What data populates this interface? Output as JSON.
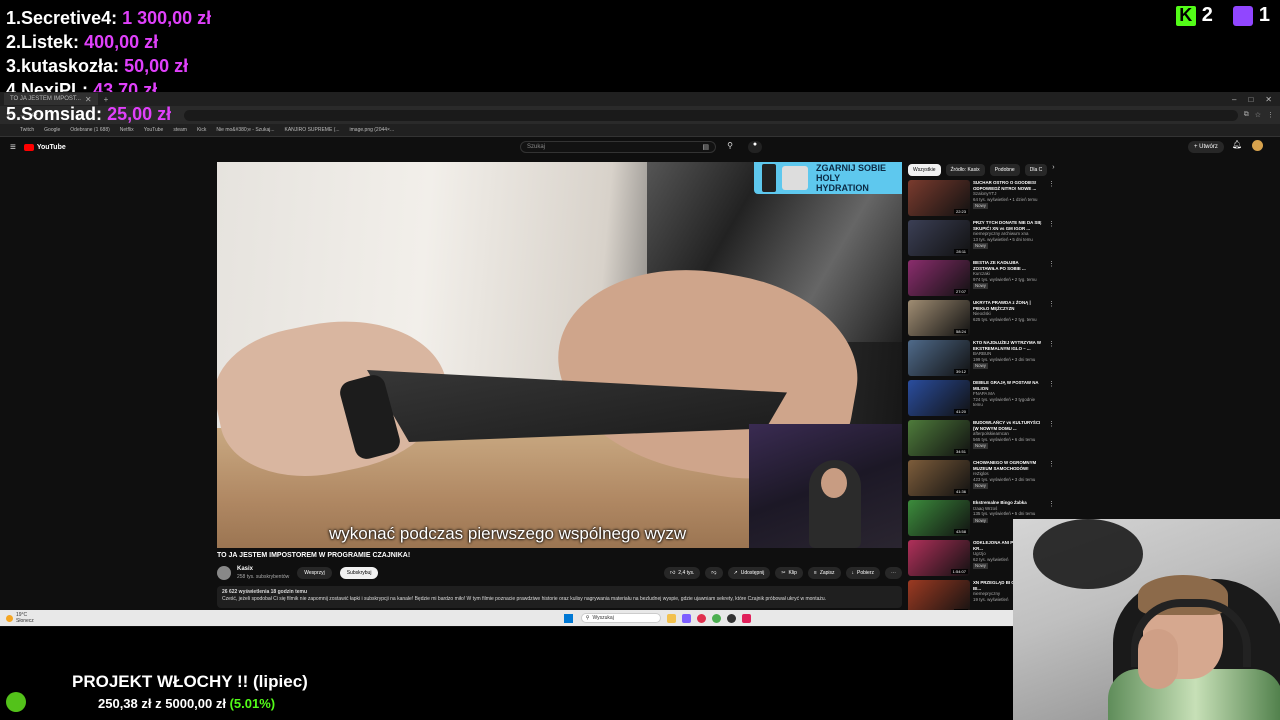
{
  "overlay": {
    "donations": [
      {
        "rank": "1.",
        "name": "Secretive4:",
        "amount": "1 300,00 zł"
      },
      {
        "rank": "2.",
        "name": "Listek:",
        "amount": "400,00 zł"
      },
      {
        "rank": "3.",
        "name": "kutaskozła:",
        "amount": "50,00 zł"
      },
      {
        "rank": "4.",
        "name": "NexiPL:",
        "amount": "43,70 zł"
      },
      {
        "rank": "5.",
        "name": "Somsiad:",
        "amount": "25,00 zł"
      }
    ],
    "kick_viewers": "2",
    "twitch_viewers": "1",
    "goal": {
      "title": "PROJEKT WŁOCHY !! (lipiec)",
      "current": "250,38 zł",
      "separator": "z",
      "target": "5000,00 zł",
      "percent": "(5.01%)"
    },
    "colors": {
      "amount": "#e040fb",
      "kick": "#53fc18",
      "twitch": "#9146ff"
    }
  },
  "browser": {
    "tab_title": "TO JA JESTEM IMPOST...",
    "bookmarks": [
      "Twitch",
      "Google",
      "Odebrane (1 688)",
      "Netflix",
      "YouTube",
      "steam",
      "Kick",
      "Nie mo&#380;e - Szukaj...",
      "KANJIRO SUPREME (...",
      "image.png (2044×..."
    ]
  },
  "youtube": {
    "logo": "YouTube",
    "search_placeholder": "Szukaj",
    "create_label": "Utwórz",
    "video": {
      "subtitle": "wykonać podczas pierwszego wspólnego wyzw",
      "ad_text": "ZGARNIJ SOBIE HOLY HYDRATION",
      "title": "TO JA JESTEM IMPOSTOREM W PROGRAMIE CZAJNIKA!",
      "channel": "Kasix",
      "subscribers": "258 tys. subskrybentów",
      "support_label": "Wesprzyj",
      "subscribed_label": "Subskrybuj",
      "likes": "2,4 tys.",
      "share_label": "Udostępnij",
      "clip_label": "Klip",
      "save_label": "Zapisz",
      "download_label": "Pobierz",
      "views_line": "26 622 wyświetlenia  18 godzin temu",
      "description": "Cześć, jeżeli spodobał Ci się filmik nie zapomnij zostawić łapki i subskrypcji na kanale! Będzie mi bardzo miło! W tym filmie poznacie prawdziwe historie oraz kulisy nagrywania materiału na bezludnej wyspie, gdzie ujawniam sekrety, które Czajnik próbował ukryć w montażu."
    },
    "chips": [
      "Wszystkie",
      "Źródło: Kasix",
      "Podobne",
      "Dla C"
    ],
    "recommendations": [
      {
        "title": "SUCHAR OSTRO O GOODIES! ODPOWIEDŹ NITRO! NOWE ...",
        "channel": "SzalonyYTJ",
        "meta": "64 tys. wyświetleń • 1 dzień temu",
        "badge": "Nowy",
        "duration": "22:23",
        "color": "#7a3b2e"
      },
      {
        "title": "PRZY TYCH DONATE NIE DA SIĘ SKUPIĆ! XN vs GM IGOR ...",
        "channel": "niemepryczny archiwum xna",
        "meta": "13 tys. wyświetleń • 5 dni temu",
        "badge": "Nowy",
        "duration": "28:11",
        "color": "#3b3f55"
      },
      {
        "title": "BESTIA ZE KADŁUBA ZOSTAWIŁA PO SOBIE ...",
        "channel": "Kurczaki",
        "meta": "974 tys. wyświetleń • 2 tyg. temu",
        "badge": "Nowy",
        "duration": "27:07",
        "color": "#8a2d6d"
      },
      {
        "title": "UKRYTA PRAWDA z ŻONĄ | PIEKŁO MĘŻCZYZN",
        "channel": "Nieoclski",
        "meta": "625 tys. wyświetleń • 2 tyg. temu",
        "badge": "",
        "duration": "58:24",
        "color": "#a08d73"
      },
      {
        "title": "KTO NAJDŁUŻEJ WYTRZYMA W EKSTREMALNYM IGLO – ...",
        "channel": "BARBUN",
        "meta": "199 tys. wyświetleń • 3 dni temu",
        "badge": "Nowy",
        "duration": "39:12",
        "color": "#4f6a8a"
      },
      {
        "title": "DEBILE GRAJĄ W POSTAW NA MILION",
        "channel": "FNAPA MA",
        "meta": "724 tys. wyświetleń • 3 tygodnie temu",
        "badge": "",
        "duration": "41:20",
        "color": "#2a4d9e"
      },
      {
        "title": "BUDOWLAŃCY vs KULTURYŚCI (W NOWYM DOMU ...",
        "channel": "afterpolskiearncan",
        "meta": "565 tys. wyświetleń • 6 dni temu",
        "badge": "Nowy",
        "duration": "34:51",
        "color": "#4e7b3b"
      },
      {
        "title": "CHOWANEGO W OGROMNYM MUZEUM SAMOCHODÓW!",
        "channel": "reZiglos",
        "meta": "423 tys. wyświetleń • 3 dni temu",
        "badge": "Nowy",
        "duration": "41:36",
        "color": "#7d5d3b"
      },
      {
        "title": "Ekstremalne Bingo Żabka",
        "channel": "Izaaq Wrzoś",
        "meta": "135 tys. wyświetleń • 5 dni temu",
        "badge": "Nowy",
        "duration": "43:58",
        "color": "#3c8c3c"
      },
      {
        "title": "ODKLEJONA ANI PRZYJAMIZLE KR...",
        "channel": "Ugrzjo",
        "meta": "62 tys. wyświetleń",
        "badge": "Nowy",
        "duration": "1:54:07",
        "color": "#b0305a"
      },
      {
        "title": "XN PRZEGLĄD BI CARROWANIE BI...",
        "channel": "niemepryczny",
        "meta": "19 tys. wyświetleń",
        "badge": "",
        "duration": "32:09",
        "color": "#9c3a22"
      }
    ]
  },
  "taskbar": {
    "weather_temp": "19°C",
    "weather_text": "Słonecz",
    "search_label": "Wyszukaj"
  }
}
